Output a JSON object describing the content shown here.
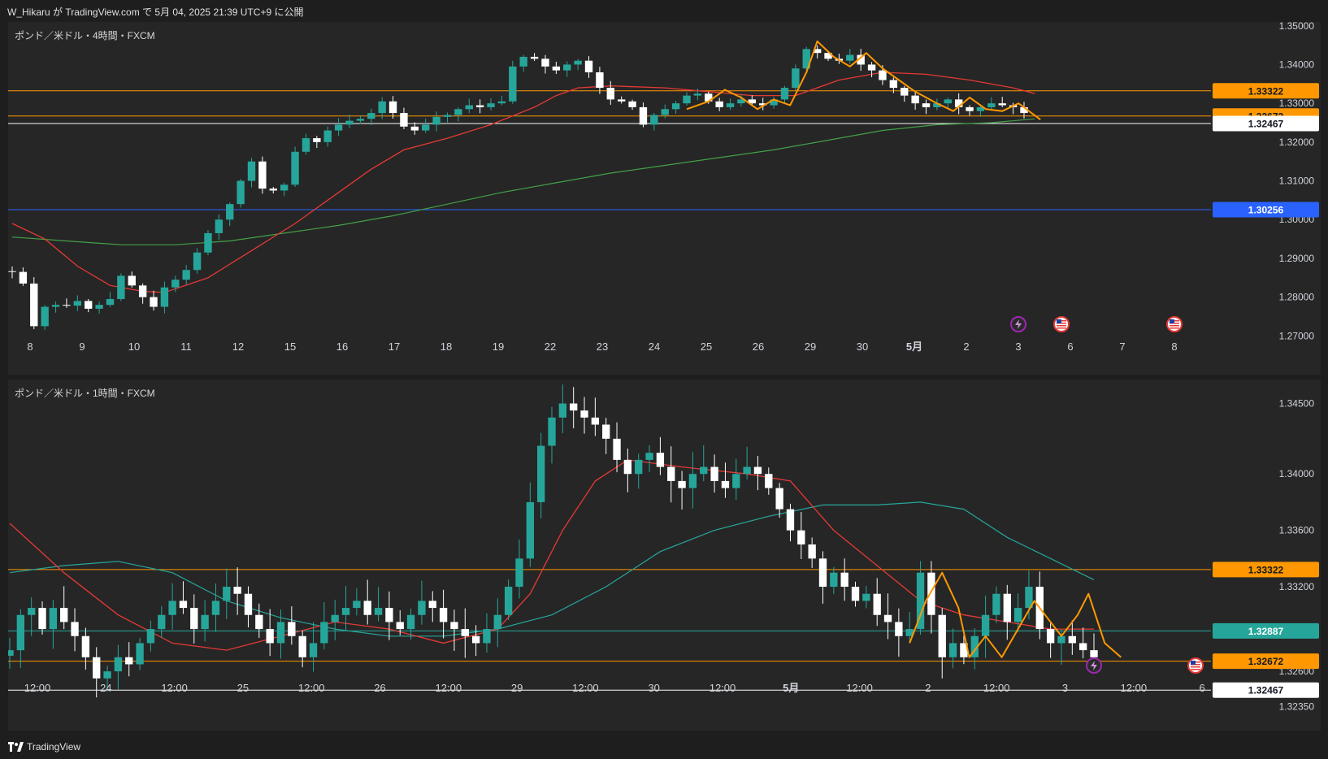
{
  "header": {
    "text": "W_Hikaru が TradingView.com で 5月 04, 2025 21:39 UTC+9 に公開"
  },
  "footer": {
    "brand": "TradingView"
  },
  "colors": {
    "bull": "#26a69a",
    "bear": "#ffffff",
    "ema_fast": "#e53935",
    "ema_slow_4h": "#43a047",
    "ema_slow_1h": "#26a69a",
    "swing": "#ff9800",
    "support": "#ffffff",
    "support_1h": "#26a69a",
    "blue_level": "#2962ff"
  },
  "chart_data": [
    {
      "type": "candlestick",
      "title": "ポンド／米ドル・4時間・FXCM",
      "ylim": [
        1.26,
        1.351
      ],
      "y_ticks": [
        "1.35000",
        "1.34000",
        "1.33000",
        "1.32000",
        "1.31000",
        "1.30000",
        "1.29000",
        "1.28000",
        "1.27000"
      ],
      "x_ticks": [
        "8",
        "9",
        "10",
        "11",
        "12",
        "15",
        "16",
        "17",
        "18",
        "19",
        "22",
        "23",
        "24",
        "25",
        "26",
        "29",
        "30",
        "5月",
        "2",
        "3",
        "6",
        "7",
        "8"
      ],
      "price_lines": [
        {
          "value": 1.33322,
          "label": "1.33322",
          "color": "#ff9800"
        },
        {
          "value": 1.32672,
          "label": "1.32672",
          "color": "#ff9800"
        },
        {
          "value": 1.3248,
          "label": "1.32467",
          "color": "#ffffff"
        },
        {
          "value": 1.30256,
          "label": "1.30256",
          "color": "#2962ff"
        }
      ],
      "ohlc_trace": [
        1.2865,
        1.2835,
        1.2725,
        1.2775,
        1.278,
        1.2778,
        1.279,
        1.277,
        1.278,
        1.2795,
        1.2855,
        1.283,
        1.28,
        1.2775,
        1.2825,
        1.2845,
        1.287,
        1.2915,
        1.2965,
        1.3,
        1.304,
        1.31,
        1.315,
        1.308,
        1.3075,
        1.309,
        1.3175,
        1.321,
        1.32,
        1.323,
        1.3245,
        1.3255,
        1.326,
        1.3275,
        1.3305,
        1.3275,
        1.324,
        1.323,
        1.3245,
        1.3265,
        1.327,
        1.3285,
        1.3295,
        1.329,
        1.33,
        1.3305,
        1.3395,
        1.342,
        1.3415,
        1.3395,
        1.3385,
        1.34,
        1.341,
        1.338,
        1.334,
        1.331,
        1.3305,
        1.329,
        1.3245,
        1.327,
        1.3285,
        1.33,
        1.332,
        1.3325,
        1.3305,
        1.329,
        1.33,
        1.331,
        1.33,
        1.3295,
        1.331,
        1.334,
        1.339,
        1.344,
        1.343,
        1.3415,
        1.341,
        1.3425,
        1.34,
        1.3385,
        1.336,
        1.334,
        1.332,
        1.33,
        1.329,
        1.33,
        1.331,
        1.329,
        1.328,
        1.329,
        1.33,
        1.3295,
        1.329,
        1.3275
      ],
      "ema_fast": [
        [
          0,
          1.299
        ],
        [
          3,
          1.295
        ],
        [
          6,
          1.288
        ],
        [
          9,
          1.283
        ],
        [
          12,
          1.2815
        ],
        [
          14,
          1.2812
        ],
        [
          18,
          1.285
        ],
        [
          22,
          1.292
        ],
        [
          26,
          1.299
        ],
        [
          30,
          1.307
        ],
        [
          33,
          1.313
        ],
        [
          36,
          1.318
        ],
        [
          40,
          1.321
        ],
        [
          44,
          1.3245
        ],
        [
          48,
          1.329
        ],
        [
          50,
          1.332
        ],
        [
          52,
          1.334
        ],
        [
          55,
          1.3345
        ],
        [
          60,
          1.334
        ],
        [
          64,
          1.333
        ],
        [
          68,
          1.332
        ],
        [
          72,
          1.332
        ],
        [
          76,
          1.336
        ],
        [
          80,
          1.338
        ],
        [
          84,
          1.3375
        ],
        [
          88,
          1.336
        ],
        [
          92,
          1.334
        ],
        [
          94,
          1.3325
        ]
      ],
      "ema_slow": [
        [
          0,
          1.2955
        ],
        [
          5,
          1.2945
        ],
        [
          10,
          1.2935
        ],
        [
          15,
          1.2935
        ],
        [
          20,
          1.2945
        ],
        [
          25,
          1.2965
        ],
        [
          30,
          1.2985
        ],
        [
          35,
          1.301
        ],
        [
          40,
          1.304
        ],
        [
          45,
          1.307
        ],
        [
          50,
          1.3095
        ],
        [
          55,
          1.312
        ],
        [
          60,
          1.314
        ],
        [
          65,
          1.316
        ],
        [
          70,
          1.318
        ],
        [
          75,
          1.3205
        ],
        [
          80,
          1.323
        ],
        [
          85,
          1.3245
        ],
        [
          90,
          1.325
        ],
        [
          94,
          1.326
        ]
      ],
      "swing": [
        [
          62,
          1.3285
        ],
        [
          64,
          1.3305
        ],
        [
          65.5,
          1.3335
        ],
        [
          67,
          1.3315
        ],
        [
          68.5,
          1.3285
        ],
        [
          70,
          1.331
        ],
        [
          71.5,
          1.3295
        ],
        [
          73,
          1.338
        ],
        [
          74,
          1.346
        ],
        [
          75.5,
          1.342
        ],
        [
          77,
          1.3395
        ],
        [
          78.5,
          1.343
        ],
        [
          80,
          1.339
        ],
        [
          81.5,
          1.336
        ],
        [
          83,
          1.333
        ],
        [
          85,
          1.33
        ],
        [
          86.5,
          1.328
        ],
        [
          88,
          1.3315
        ],
        [
          89.5,
          1.3285
        ],
        [
          91,
          1.328
        ],
        [
          92.5,
          1.33
        ],
        [
          94.5,
          1.3258
        ]
      ],
      "events": [
        {
          "index": 93,
          "kind": "lightning"
        },
        {
          "index": 97,
          "kind": "us-flag"
        },
        {
          "index": 107,
          "kind": "us-flag"
        }
      ]
    },
    {
      "type": "candlestick",
      "title": "ポンド／米ドル・1時間・FXCM",
      "ylim": [
        1.3218,
        1.3467
      ],
      "y_ticks": [
        "1.34500",
        "1.34000",
        "1.33600",
        "1.33200",
        "1.32600",
        "1.32350"
      ],
      "x_ticks": [
        "12:00",
        "24",
        "12:00",
        "25",
        "12:00",
        "26",
        "12:00",
        "29",
        "12:00",
        "30",
        "12:00",
        "5月",
        "12:00",
        "2",
        "12:00",
        "3",
        "12:00",
        "6"
      ],
      "price_lines": [
        {
          "value": 1.33322,
          "label": "1.33322",
          "color": "#ff9800"
        },
        {
          "value": 1.32887,
          "label": "1.32887",
          "color": "#26a69a"
        },
        {
          "value": 1.32672,
          "label": "1.32672",
          "color": "#ff9800"
        },
        {
          "value": 1.32467,
          "label": "1.32467",
          "color": "#ffffff"
        }
      ],
      "ohlc_trace": [
        1.3275,
        1.33,
        1.3305,
        1.329,
        1.3305,
        1.3295,
        1.3285,
        1.327,
        1.3255,
        1.326,
        1.327,
        1.3265,
        1.328,
        1.329,
        1.33,
        1.331,
        1.3305,
        1.329,
        1.33,
        1.331,
        1.332,
        1.3315,
        1.33,
        1.329,
        1.328,
        1.3295,
        1.3285,
        1.327,
        1.328,
        1.3295,
        1.33,
        1.3305,
        1.331,
        1.33,
        1.3305,
        1.3295,
        1.329,
        1.33,
        1.331,
        1.3305,
        1.3295,
        1.329,
        1.3285,
        1.328,
        1.329,
        1.33,
        1.332,
        1.334,
        1.338,
        1.342,
        1.344,
        1.345,
        1.3445,
        1.344,
        1.3435,
        1.3425,
        1.341,
        1.34,
        1.341,
        1.3415,
        1.3405,
        1.3395,
        1.339,
        1.34,
        1.3405,
        1.3395,
        1.339,
        1.34,
        1.3405,
        1.34,
        1.339,
        1.3375,
        1.336,
        1.335,
        1.334,
        1.332,
        1.333,
        1.332,
        1.331,
        1.3315,
        1.33,
        1.3295,
        1.3285,
        1.329,
        1.333,
        1.33,
        1.327,
        1.328,
        1.327,
        1.3285,
        1.33,
        1.3315,
        1.3295,
        1.3305,
        1.332,
        1.329,
        1.328,
        1.3285,
        1.328,
        1.3275,
        1.327
      ],
      "ema_fast": [
        [
          0,
          1.3365
        ],
        [
          5,
          1.333
        ],
        [
          10,
          1.33
        ],
        [
          15,
          1.328
        ],
        [
          20,
          1.3275
        ],
        [
          25,
          1.3285
        ],
        [
          30,
          1.3295
        ],
        [
          35,
          1.329
        ],
        [
          40,
          1.328
        ],
        [
          45,
          1.329
        ],
        [
          48,
          1.3315
        ],
        [
          51,
          1.336
        ],
        [
          54,
          1.3395
        ],
        [
          57,
          1.341
        ],
        [
          62,
          1.3405
        ],
        [
          68,
          1.34
        ],
        [
          72,
          1.3395
        ],
        [
          76,
          1.336
        ],
        [
          80,
          1.3335
        ],
        [
          84,
          1.331
        ],
        [
          88,
          1.33
        ],
        [
          92,
          1.3295
        ],
        [
          96,
          1.329
        ],
        [
          100,
          1.329
        ]
      ],
      "ema_slow": [
        [
          0,
          1.333
        ],
        [
          5,
          1.3335
        ],
        [
          10,
          1.3338
        ],
        [
          15,
          1.333
        ],
        [
          20,
          1.331
        ],
        [
          25,
          1.3298
        ],
        [
          30,
          1.329
        ],
        [
          35,
          1.3285
        ],
        [
          40,
          1.3285
        ],
        [
          45,
          1.329
        ],
        [
          50,
          1.33
        ],
        [
          55,
          1.332
        ],
        [
          60,
          1.3345
        ],
        [
          65,
          1.336
        ],
        [
          70,
          1.337
        ],
        [
          75,
          1.3378
        ],
        [
          80,
          1.3378
        ],
        [
          84,
          1.338
        ],
        [
          88,
          1.3375
        ],
        [
          92,
          1.3355
        ],
        [
          96,
          1.334
        ],
        [
          100,
          1.3325
        ]
      ],
      "swing": [
        [
          83,
          1.328
        ],
        [
          84.5,
          1.331
        ],
        [
          86,
          1.333
        ],
        [
          87.5,
          1.3305
        ],
        [
          88.5,
          1.327
        ],
        [
          90,
          1.3285
        ],
        [
          91.5,
          1.327
        ],
        [
          93,
          1.329
        ],
        [
          94.5,
          1.331
        ],
        [
          96,
          1.3295
        ],
        [
          97,
          1.3285
        ],
        [
          98.5,
          1.33
        ],
        [
          99.5,
          1.3315
        ],
        [
          101,
          1.328
        ],
        [
          102.5,
          1.327
        ]
      ],
      "events": [
        {
          "index": 101,
          "kind": "lightning"
        },
        {
          "index": 108,
          "kind": "us-flag"
        }
      ]
    }
  ]
}
